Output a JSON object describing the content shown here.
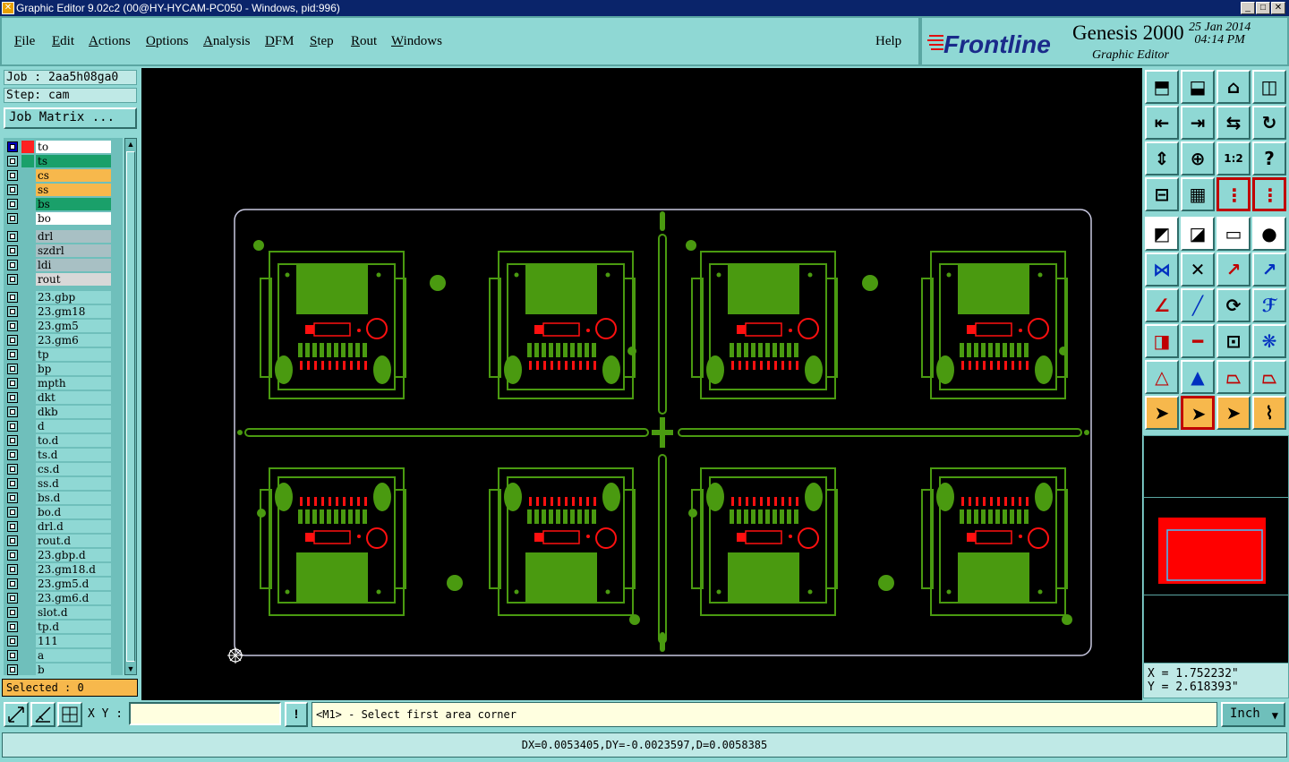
{
  "window": {
    "title": "Graphic Editor 9.02c2 (00@HY-HYCAM-PC050 - Windows, pid:996)"
  },
  "menu": [
    {
      "key": "F",
      "rest": "ile"
    },
    {
      "key": "E",
      "rest": "dit"
    },
    {
      "key": "A",
      "rest": "ctions"
    },
    {
      "key": "O",
      "rest": "ptions"
    },
    {
      "key": "A",
      "rest": "nalysis"
    },
    {
      "key": "D",
      "rest": "FM"
    },
    {
      "key": "S",
      "rest": "tep"
    },
    {
      "key": "R",
      "rest": "out"
    },
    {
      "key": "W",
      "rest": "indows"
    }
  ],
  "help_label": "Help",
  "brand": {
    "logo": "Frontline",
    "product": "Genesis 2000",
    "subtitle": "Graphic Editor",
    "date": "25 Jan 2014",
    "time": "04:14 PM"
  },
  "job": "Job : 2aa5h08ga0",
  "step": "Step: cam",
  "job_matrix_label": "Job Matrix ...",
  "layers": [
    {
      "name": "to",
      "bg": "#ffffff",
      "color": "#ff2020",
      "selected": true,
      "mark": "▣"
    },
    {
      "name": "ts",
      "bg": "#1aa06a",
      "color": "#1aa06a",
      "selected": false,
      "mark": ""
    },
    {
      "name": "cs",
      "bg": "#f7b84c",
      "color": "",
      "selected": false,
      "mark": "✐"
    },
    {
      "name": "ss",
      "bg": "#f7b84c",
      "color": "",
      "selected": false,
      "mark": "✐"
    },
    {
      "name": "bs",
      "bg": "#1aa06a",
      "color": "",
      "selected": false,
      "mark": ""
    },
    {
      "name": "bo",
      "bg": "#ffffff",
      "color": "",
      "selected": false,
      "mark": ""
    },
    {
      "name": "drl",
      "bg": "#a8c0c4",
      "color": "",
      "selected": false,
      "mark": ""
    },
    {
      "name": "szdrl",
      "bg": "#a8c0c4",
      "color": "",
      "selected": false,
      "mark": ""
    },
    {
      "name": "ldi",
      "bg": "#a8c0c4",
      "color": "",
      "selected": false,
      "mark": ""
    },
    {
      "name": "rout",
      "bg": "#d8d8d8",
      "color": "",
      "selected": false,
      "mark": ""
    },
    {
      "name": "23.gbp",
      "bg": "#8fd8d4",
      "color": "",
      "selected": false,
      "mark": ""
    },
    {
      "name": "23.gm18",
      "bg": "#8fd8d4",
      "color": "",
      "selected": false,
      "mark": "✐"
    },
    {
      "name": "23.gm5",
      "bg": "#8fd8d4",
      "color": "",
      "selected": false,
      "mark": "✐"
    },
    {
      "name": "23.gm6",
      "bg": "#8fd8d4",
      "color": "",
      "selected": false,
      "mark": ""
    },
    {
      "name": "tp",
      "bg": "#8fd8d4",
      "color": "",
      "selected": false,
      "mark": ""
    },
    {
      "name": "bp",
      "bg": "#8fd8d4",
      "color": "",
      "selected": false,
      "mark": ""
    },
    {
      "name": "mpth",
      "bg": "#8fd8d4",
      "color": "",
      "selected": false,
      "mark": ""
    },
    {
      "name": "dkt",
      "bg": "#8fd8d4",
      "color": "",
      "selected": false,
      "mark": ""
    },
    {
      "name": "dkb",
      "bg": "#8fd8d4",
      "color": "",
      "selected": false,
      "mark": ""
    },
    {
      "name": "d",
      "bg": "#8fd8d4",
      "color": "",
      "selected": false,
      "mark": ""
    },
    {
      "name": "to.d",
      "bg": "#8fd8d4",
      "color": "",
      "selected": false,
      "mark": ""
    },
    {
      "name": "ts.d",
      "bg": "#8fd8d4",
      "color": "",
      "selected": false,
      "mark": ""
    },
    {
      "name": "cs.d",
      "bg": "#8fd8d4",
      "color": "",
      "selected": false,
      "mark": "✐"
    },
    {
      "name": "ss.d",
      "bg": "#8fd8d4",
      "color": "",
      "selected": false,
      "mark": "✐"
    },
    {
      "name": "bs.d",
      "bg": "#8fd8d4",
      "color": "",
      "selected": false,
      "mark": ""
    },
    {
      "name": "bo.d",
      "bg": "#8fd8d4",
      "color": "",
      "selected": false,
      "mark": ""
    },
    {
      "name": "drl.d",
      "bg": "#8fd8d4",
      "color": "",
      "selected": false,
      "mark": ""
    },
    {
      "name": "rout.d",
      "bg": "#8fd8d4",
      "color": "",
      "selected": false,
      "mark": ""
    },
    {
      "name": "23.gbp.d",
      "bg": "#8fd8d4",
      "color": "",
      "selected": false,
      "mark": ""
    },
    {
      "name": "23.gm18.d",
      "bg": "#8fd8d4",
      "color": "",
      "selected": false,
      "mark": "✐"
    },
    {
      "name": "23.gm5.d",
      "bg": "#8fd8d4",
      "color": "",
      "selected": false,
      "mark": "✐"
    },
    {
      "name": "23.gm6.d",
      "bg": "#8fd8d4",
      "color": "",
      "selected": false,
      "mark": ""
    },
    {
      "name": "slot.d",
      "bg": "#8fd8d4",
      "color": "",
      "selected": false,
      "mark": ""
    },
    {
      "name": "tp.d",
      "bg": "#8fd8d4",
      "color": "",
      "selected": false,
      "mark": ""
    },
    {
      "name": "111",
      "bg": "#8fd8d4",
      "color": "",
      "selected": false,
      "mark": ""
    },
    {
      "name": "a",
      "bg": "#8fd8d4",
      "color": "",
      "selected": false,
      "mark": ""
    },
    {
      "name": "b",
      "bg": "#8fd8d4",
      "color": "",
      "selected": false,
      "mark": ""
    }
  ],
  "selected_label": "Selected : 0",
  "xy_label": "X Y :",
  "xy_value": "",
  "prompt": "<M1> - Select first area corner",
  "units": "Inch",
  "status": "DX=0.0053405,DY=-0.0023597,D=0.0058385",
  "coords": {
    "x": "X = 1.752232\"",
    "y": "Y = 2.618393\""
  },
  "colors": {
    "pcb_green": "#4a9a10",
    "silk_red": "#ff1010",
    "outline": "#c8c8e0",
    "overview_red": "#ff0000"
  },
  "tools": [
    "home-view-icon",
    "zoom-home-icon",
    "home-icon",
    "split-view-icon",
    "pan-left-icon",
    "pan-right-icon",
    "swap-icon",
    "redraw-icon",
    "fit-vertical-icon",
    "zoom-fit-icon",
    "scale-1-2-icon",
    "help-icon",
    "measure-icon",
    "grid-icon",
    "layer-compare-icon",
    "layer-compare-2-icon",
    "pad-add-icon",
    "line-add-icon",
    "ruler-icon",
    "circle-icon",
    "node-connect-icon",
    "feature-delete-icon",
    "move-point-icon",
    "rotate-point-icon",
    "angle-icon",
    "draw-line-icon",
    "arc-icon",
    "mirror-text-icon",
    "copy-feature-icon",
    "split-line-icon",
    "align-icon",
    "merge-icon",
    "triangle-icon",
    "triangle-up-icon",
    "trapezoid-icon",
    "trapezoid-cut-icon",
    "pointer-icon",
    "pointer-box-icon",
    "pointer-select-icon",
    "route-icon"
  ]
}
